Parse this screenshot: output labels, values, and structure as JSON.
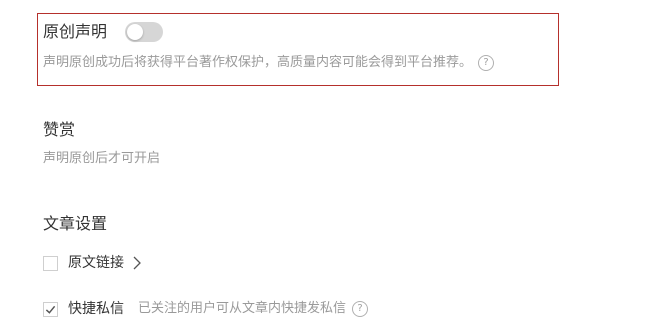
{
  "original": {
    "title": "原创声明",
    "toggle_on": false,
    "description": "声明原创成功后将获得平台著作权保护，高质量内容可能会得到平台推荐。",
    "help_icon": "question-circle-icon",
    "highlight_color": "#b5302c"
  },
  "reward": {
    "title": "赞赏",
    "description": "声明原创后才可开启"
  },
  "article_settings": {
    "title": "文章设置",
    "original_link": {
      "label": "原文链接",
      "checked": false,
      "chevron": ">"
    },
    "quick_message": {
      "label": "快捷私信",
      "checked": true,
      "hint": "已关注的用户可从文章内快捷发私信",
      "help_icon": "question-circle-icon"
    }
  }
}
